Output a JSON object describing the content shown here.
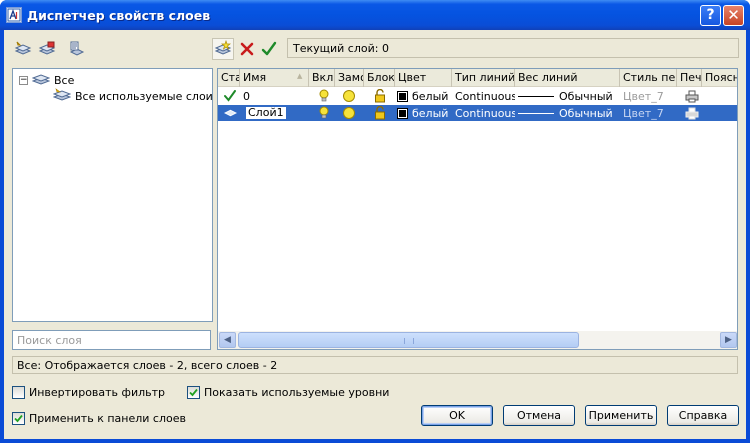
{
  "window": {
    "title": "Диспетчер свойств слоев",
    "help_glyph": "?",
    "close_glyph": "✕"
  },
  "toolbar": {
    "left_tools": [
      "new-properties-filter-icon",
      "new-group-filter-icon",
      "layer-states-manager-icon"
    ],
    "right_tools": [
      "new-layer-icon",
      "delete-layer-icon",
      "set-current-icon"
    ],
    "current_layer": "Текущий слой: 0"
  },
  "tree": {
    "root": "Все",
    "child": "Все используемые слои",
    "expander": "−"
  },
  "search": {
    "placeholder": "Поиск слоя"
  },
  "grid": {
    "columns": [
      "Ста",
      "Имя",
      "Вкл",
      "Замо",
      "Блок",
      "Цвет",
      "Тип линий",
      "Вес линий",
      "Стиль пе",
      "Печ",
      "Поясн"
    ],
    "sort_glyph": "▲",
    "rows": [
      {
        "status": "current",
        "name": "0",
        "color": "белый",
        "linetype": "Continuous",
        "lineweight": "Обычный",
        "plotstyle": "Цвет_7",
        "selected": false
      },
      {
        "status": "layer",
        "name": "Слой1",
        "color": "белый",
        "linetype": "Continuous",
        "lineweight": "Обычный",
        "plotstyle": "Цвет_7",
        "selected": true
      }
    ]
  },
  "status_text": "Все: Отображается слоев - 2, всего слоев - 2",
  "options": {
    "invert_filter": {
      "label": "Инвертировать фильтр",
      "checked": false
    },
    "apply_to_toolbar": {
      "label": "Применить к панели слоев",
      "checked": true
    },
    "show_used": {
      "label": "Показать используемые уровни",
      "checked": true
    }
  },
  "buttons": {
    "ok": "OK",
    "cancel": "Отмена",
    "apply": "Применить",
    "help": "Справка"
  },
  "colors": {
    "title_blue": "#0553e0",
    "selection": "#316ac5",
    "face": "#ece9d8",
    "check_green": "#1f8a2a",
    "delete_red": "#c81b1b",
    "bulb_yellow": "#f6e23a"
  }
}
